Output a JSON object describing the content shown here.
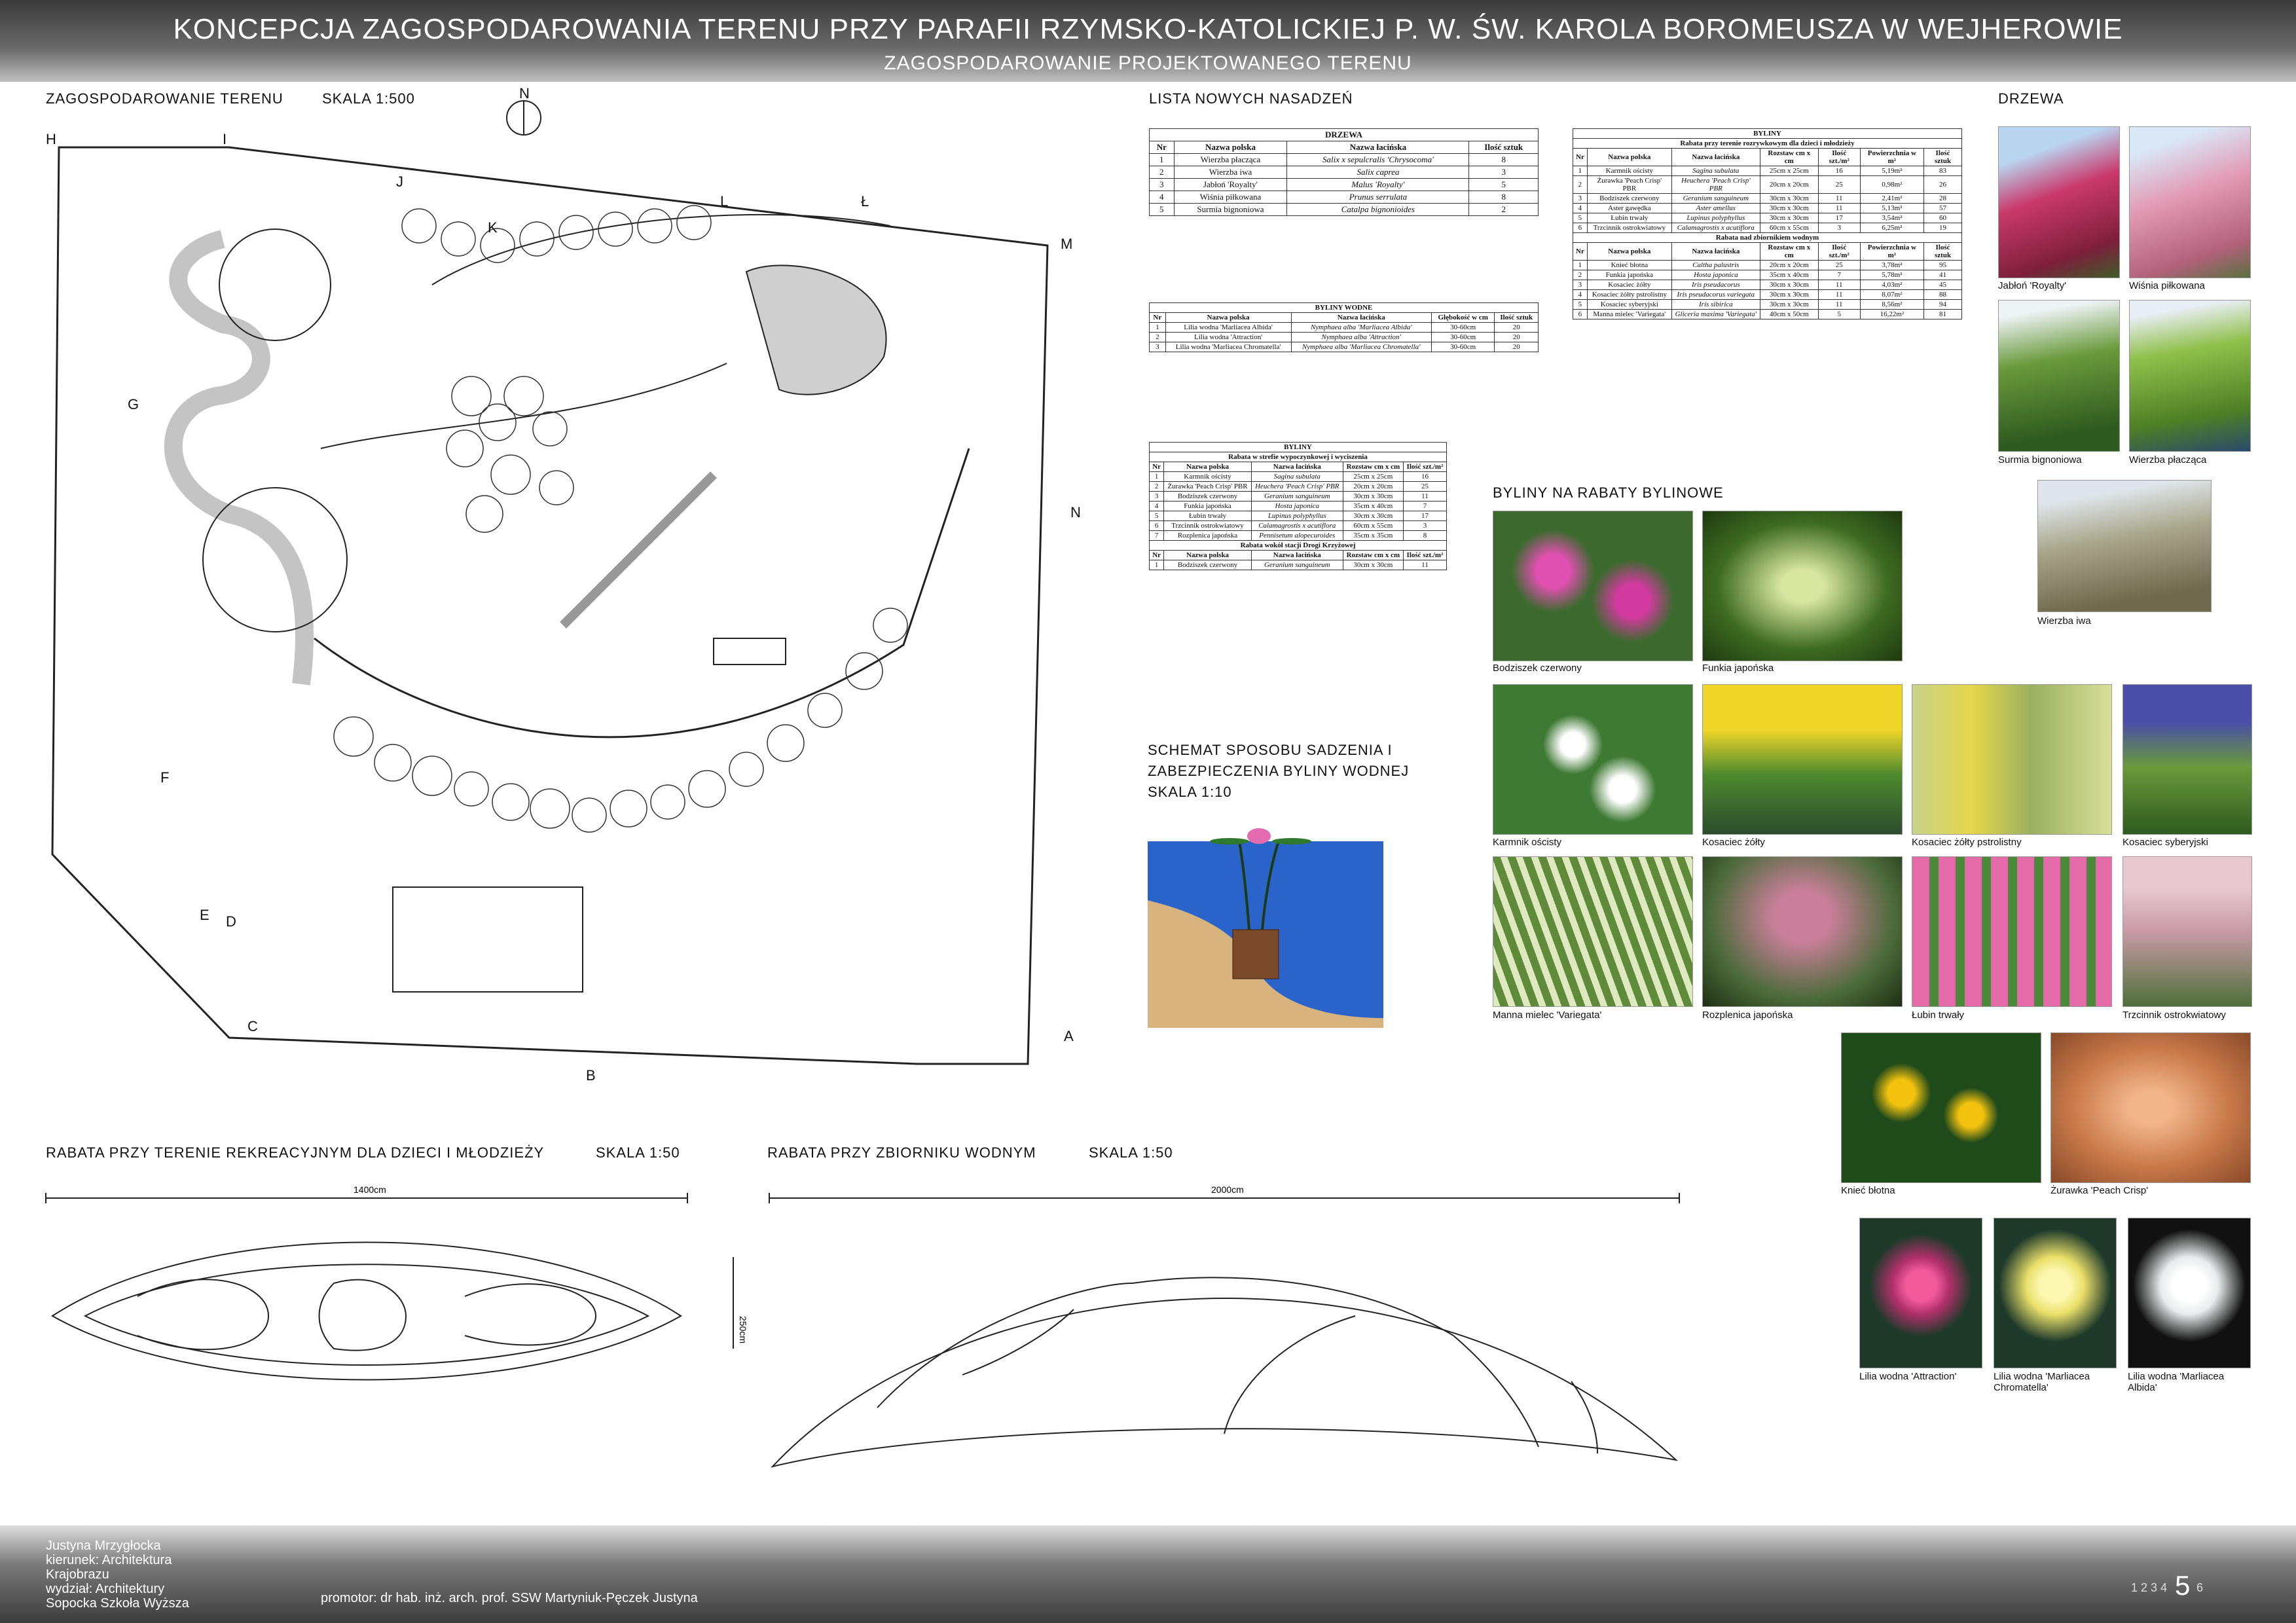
{
  "header": {
    "title": "KONCEPCJA ZAGOSPODAROWANIA TERENU PRZY PARAFII RZYMSKO-KATOLICKIEJ P. W. ŚW. KAROLA BOROMEUSZA W WEJHEROWIE",
    "subtitle": "ZAGOSPODAROWANIE PROJEKTOWANEGO TERENU"
  },
  "plan": {
    "title": "ZAGOSPODAROWANIE TERENU",
    "scale": "SKALA 1:500",
    "north": "N",
    "points": {
      "H": "H",
      "I": "I",
      "J": "J",
      "K": "K",
      "L": "L",
      "L2": "Ł",
      "M": "M",
      "N": "N",
      "A": "A",
      "B": "B",
      "C": "C",
      "D": "D",
      "E": "E",
      "F": "F",
      "G": "G"
    }
  },
  "list_title": "LISTA NOWYCH NASADZEŃ",
  "drzewa_table": {
    "caption": "DRZEWA",
    "headers": [
      "Nr",
      "Nazwa polska",
      "Nazwa łacińska",
      "Ilość sztuk"
    ],
    "rows": [
      [
        "1",
        "Wierzba płacząca",
        "Salix x sepulcralis 'Chrysocoma'",
        "8"
      ],
      [
        "2",
        "Wierzba iwa",
        "Salix caprea",
        "3"
      ],
      [
        "3",
        "Jabłoń 'Royalty'",
        "Malus 'Royalty'",
        "5"
      ],
      [
        "4",
        "Wiśnia piłkowana",
        "Prunus serrulata",
        "8"
      ],
      [
        "5",
        "Surmia bignoniowa",
        "Catalpa bignonioides",
        "2"
      ]
    ]
  },
  "wodne_table": {
    "caption": "BYLINY WODNE",
    "headers": [
      "Nr",
      "Nazwa polska",
      "Nazwa łacińska",
      "Głębokość w cm",
      "Ilość sztuk"
    ],
    "rows": [
      [
        "1",
        "Lilia wodna 'Marliacea Albida'",
        "Nymphaea alba 'Marliacea Albida'",
        "30-60cm",
        "20"
      ],
      [
        "2",
        "Lilia wodna 'Attraction'",
        "Nymphaea alba 'Attraction'",
        "30-60cm",
        "20"
      ],
      [
        "3",
        "Lilia wodna 'Marliacea Chromatella'",
        "Nymphaea alba 'Marliacea Chromatella'",
        "30-60cm",
        "20"
      ]
    ]
  },
  "byliny_left": {
    "caption": "BYLINY",
    "sub1": "Rabata w strefie wypoczynkowej i wyciszenia",
    "headers": [
      "Nr",
      "Nazwa polska",
      "Nazwa łacińska",
      "Rozstaw cm x cm",
      "Ilość szt./m²"
    ],
    "rows": [
      [
        "1",
        "Karmnik ościsty",
        "Sagina subulata",
        "25cm x 25cm",
        "16"
      ],
      [
        "2",
        "Żurawka 'Peach Crisp' PBR",
        "Heuchera 'Peach Crisp' PBR",
        "20cm x 20cm",
        "25"
      ],
      [
        "3",
        "Bodziszek czerwony",
        "Geranium sanguineum",
        "30cm x 30cm",
        "11"
      ],
      [
        "4",
        "Funkia japońska",
        "Hosta japonica",
        "35cm x 40cm",
        "7"
      ],
      [
        "5",
        "Łubin trwały",
        "Lupinus polyphyllus",
        "30cm x 30cm",
        "17"
      ],
      [
        "6",
        "Trzcinnik ostrokwiatowy",
        "Calamagrostis x acutiflora",
        "60cm x 55cm",
        "3"
      ],
      [
        "7",
        "Rozplenica japońska",
        "Pennisetum alopecuroides",
        "35cm x 35cm",
        "8"
      ]
    ],
    "sub2": "Rabata wokół stacji Drogi Krzyżowej",
    "rows2": [
      [
        "1",
        "Bodziszek czerwony",
        "Geranium sanguineum",
        "30cm x 30cm",
        "11"
      ]
    ]
  },
  "byliny_right": {
    "caption": "BYLINY",
    "sub1": "Rabata przy terenie rozrywkowym dla dzieci i młodzieży",
    "headers": [
      "Nr",
      "Nazwa polska",
      "Nazwa łacińska",
      "Rozstaw cm x cm",
      "Ilość szt./m²",
      "Powierzchnia w m²",
      "Ilość sztuk"
    ],
    "rows": [
      [
        "1",
        "Karmnik ościsty",
        "Sagina subulata",
        "25cm x 25cm",
        "16",
        "5,19m²",
        "83"
      ],
      [
        "2",
        "Żurawka 'Peach Crisp' PBR",
        "Heuchera 'Peach Crisp' PBR",
        "20cm x 20cm",
        "25",
        "0,98m²",
        "26"
      ],
      [
        "3",
        "Bodziszek czerwony",
        "Geranium sanguineum",
        "30cm x 30cm",
        "11",
        "2,41m²",
        "28"
      ],
      [
        "4",
        "Aster gawędka",
        "Aster amellus",
        "30cm x 30cm",
        "11",
        "5,13m²",
        "57"
      ],
      [
        "5",
        "Łubin trwały",
        "Lupinus polyphyllus",
        "30cm x 30cm",
        "17",
        "3,54m²",
        "60"
      ],
      [
        "6",
        "Trzcinnik ostrokwiatowy",
        "Calamagrostis x acutiflora",
        "60cm x 55cm",
        "3",
        "6,25m²",
        "19"
      ]
    ],
    "sub2": "Rabata nad zbiornikiem wodnym",
    "rows2": [
      [
        "1",
        "Knieć błotna",
        "Caltha palustris",
        "20cm x 20cm",
        "25",
        "3,78m²",
        "95"
      ],
      [
        "2",
        "Funkia japońska",
        "Hosta japonica",
        "35cm x 40cm",
        "7",
        "5,78m²",
        "41"
      ],
      [
        "3",
        "Kosaciec żółty",
        "Iris pseudacorus",
        "30cm x 30cm",
        "11",
        "4,03m²",
        "45"
      ],
      [
        "4",
        "Kosaciec żółty pstrolistny",
        "Iris pseudacorus variegata",
        "30cm x 30cm",
        "11",
        "8,07m²",
        "88"
      ],
      [
        "5",
        "Kosaciec syberyjski",
        "Iris sibirica",
        "30cm x 30cm",
        "11",
        "8,56m²",
        "94"
      ],
      [
        "6",
        "Manna mielec 'Variegata'",
        "Gliceria maxima 'Variegata'",
        "40cm x 50cm",
        "5",
        "16,22m²",
        "81"
      ]
    ]
  },
  "schemat": {
    "line1": "SCHEMAT SPOSOBU SADZENIA I",
    "line2": "ZABEZPIECZENIA BYLINY WODNEJ",
    "line3": "SKALA 1:10"
  },
  "drzewa_title": "DRZEWA",
  "tree_photos": [
    "Jabłoń 'Royalty'",
    "Wiśnia piłkowana",
    "Surmia bignoniowa",
    "Wierzba płacząca",
    "Wierzba iwa"
  ],
  "byliny_title": "BYLINY NA RABATY BYLINOWE",
  "plant_photos": [
    "Bodziszek czerwony",
    "Funkia japońska",
    "Karmnik ościsty",
    "Kosaciec żółty",
    "Kosaciec żółty pstrolistny",
    "Kosaciec syberyjski",
    "Manna mielec 'Variegata'",
    "Rozplenica japońska",
    "Łubin trwały",
    "Trzcinnik ostrokwiatowy",
    "Knieć błotna",
    "Żurawka 'Peach Crisp'",
    "Lilia wodna 'Attraction'",
    "Lilia wodna 'Marliacea Chromatella'",
    "Lilia wodna 'Marliacea Albida'"
  ],
  "rabata1": {
    "title": "RABATA PRZY TERENIE REKREACYJNYM DLA DZIECI I MŁODZIEŻY",
    "scale": "SKALA 1:50",
    "width": "1400cm",
    "height": "250cm"
  },
  "rabata2": {
    "title": "RABATA PRZY ZBIORNIKU WODNYM",
    "scale": "SKALA 1:50",
    "width": "2000cm"
  },
  "footer": {
    "author": "Justyna Mrzygłocka",
    "line2": "kierunek: Architektura",
    "line3": "Krajobrazu",
    "line4": "wydział: Architektury",
    "line5": "Sopocka Szkoła Wyższa",
    "promotor": "promotor:  dr hab. inż. arch. prof. SSW Martyniuk-Pęczek Justyna",
    "pages": "1 2 3 4",
    "current": "5",
    "next": "6"
  }
}
